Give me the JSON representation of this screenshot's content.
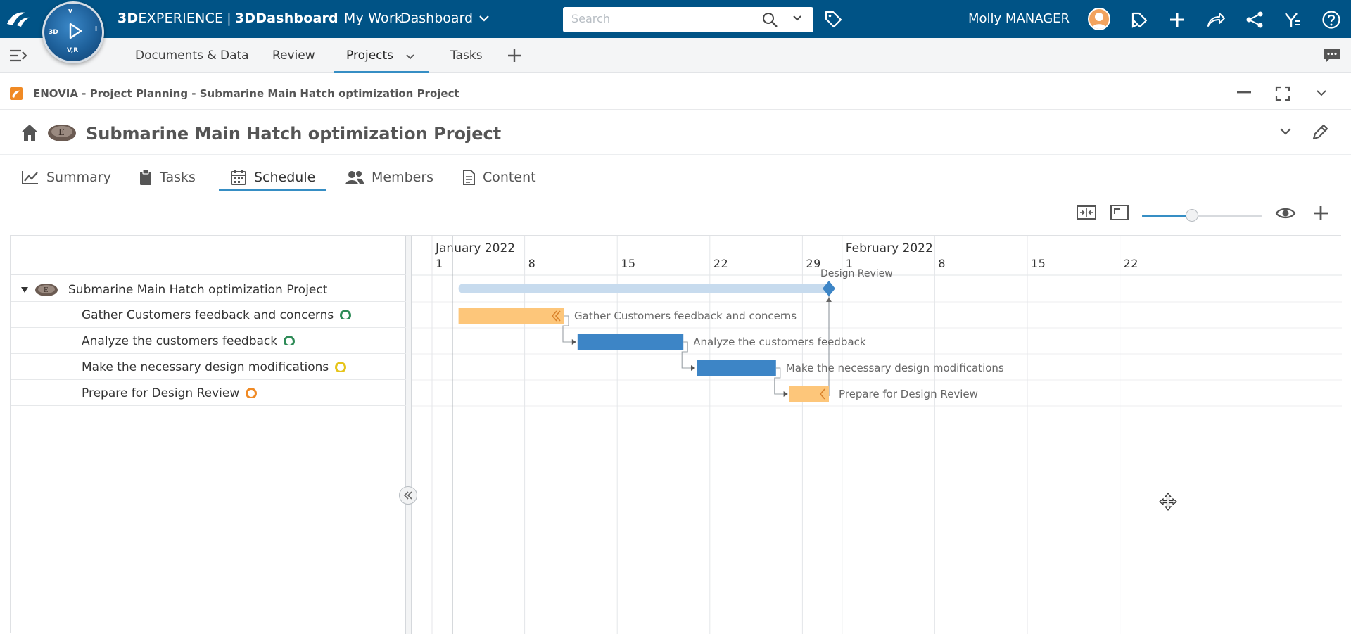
{
  "topbar": {
    "brand_prefix": "3D",
    "brand_experience": "EXPERIENCE",
    "brand_app": "3DDashboard",
    "mywork": "My Work",
    "dashboard_label": "Dashboard",
    "search_placeholder": "Search",
    "user_name": "Molly MANAGER",
    "compass_top": "V,R",
    "compass_left": "3D",
    "compass_right": "i",
    "compass_top_letters": "v"
  },
  "secondbar": {
    "tabs": [
      "Documents & Data",
      "Review",
      "Projects",
      "Tasks"
    ],
    "active_tab": "Projects"
  },
  "app": {
    "window_title": "ENOVIA - Project Planning - Submarine Main Hatch optimization Project",
    "project_title": "Submarine Main Hatch optimization Project",
    "tabs": [
      "Summary",
      "Tasks",
      "Schedule",
      "Members",
      "Content"
    ],
    "active_tab": "Schedule"
  },
  "toolbar": {
    "zoom_fraction": 0.42
  },
  "gantt": {
    "months": [
      {
        "label": "January 2022",
        "start": "2022-01-01"
      },
      {
        "label": "February 2022",
        "start": "2022-02-01"
      }
    ],
    "day_ticks": [
      {
        "label": "1",
        "date": "2022-01-01"
      },
      {
        "label": "8",
        "date": "2022-01-08"
      },
      {
        "label": "15",
        "date": "2022-01-15"
      },
      {
        "label": "22",
        "date": "2022-01-22"
      },
      {
        "label": "29",
        "date": "2022-01-29"
      },
      {
        "label": "1",
        "date": "2022-02-01"
      },
      {
        "label": "8",
        "date": "2022-02-08"
      },
      {
        "label": "15",
        "date": "2022-02-15"
      },
      {
        "label": "22",
        "date": "2022-02-22"
      }
    ],
    "today": "2022-01-02",
    "project": {
      "name": "Submarine Main Hatch optimization Project",
      "start": "2022-01-03",
      "end": "2022-01-31"
    },
    "milestone": {
      "name": "Design Review",
      "date": "2022-01-31"
    },
    "tasks": [
      {
        "name": "Gather Customers feedback and concerns",
        "start": "2022-01-03",
        "end": "2022-01-11",
        "status": "complete",
        "color": "#fdc67a",
        "assignee_color": "#2e8b57"
      },
      {
        "name": "Analyze the customers feedback",
        "start": "2022-01-12",
        "end": "2022-01-20",
        "status": "in-progress",
        "color": "#3d85c6",
        "assignee_color": "#2e8b57"
      },
      {
        "name": "Make the necessary design modifications",
        "start": "2022-01-21",
        "end": "2022-01-27",
        "status": "in-progress",
        "color": "#3d85c6",
        "assignee_color": "#e6c419"
      },
      {
        "name": "Prepare for Design Review",
        "start": "2022-01-28",
        "end": "2022-01-31",
        "status": "complete",
        "color": "#fdc67a",
        "assignee_color": "#f08a24"
      }
    ]
  }
}
